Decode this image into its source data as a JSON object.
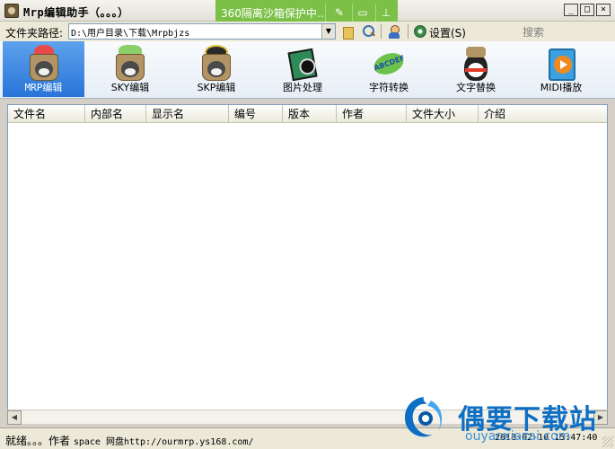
{
  "window": {
    "title": "Mrp编辑助手（。。。）",
    "min": "_",
    "max": "□",
    "close": "×"
  },
  "sandbox": {
    "text": "360隔离沙箱保护中..."
  },
  "address": {
    "label": "文件夹路径:",
    "value": "D:\\用户目录\\下载\\Mrpbjzs",
    "settings_label": "设置(S)",
    "search_label": "搜索"
  },
  "toolbar": {
    "items": [
      {
        "label": "MRP编辑"
      },
      {
        "label": "SKY编辑"
      },
      {
        "label": "SKP编辑"
      },
      {
        "label": "图片处理"
      },
      {
        "label": "字符转换"
      },
      {
        "label": "文字替换"
      },
      {
        "label": "MIDI播放"
      }
    ],
    "glyph_text": "ABCDEF"
  },
  "list": {
    "columns": [
      "文件名",
      "内部名",
      "显示名",
      "编号",
      "版本",
      "作者",
      "文件大小",
      "介绍"
    ]
  },
  "status": {
    "text": "就绪。。。作者",
    "detail": "space 网盘http://ourmrp.ys168.com/",
    "time": "2018-02-10 15:47:40"
  },
  "watermark": {
    "title": "偶要下载站",
    "url": "ouyaoxiazai.com"
  }
}
